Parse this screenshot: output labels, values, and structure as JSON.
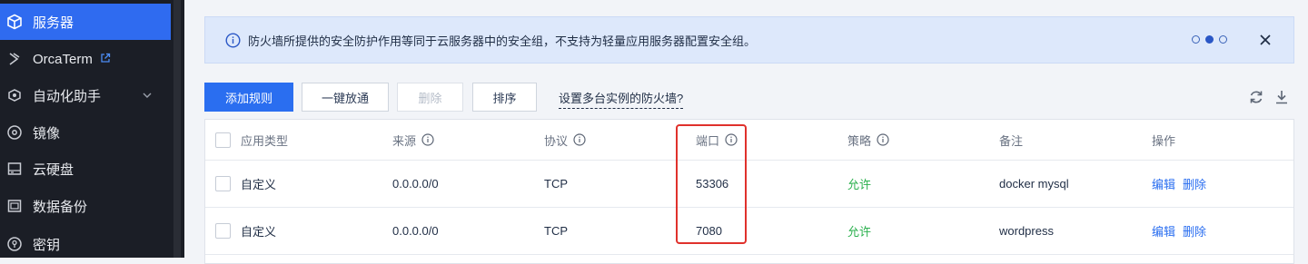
{
  "sidebar": {
    "items": [
      {
        "label": "服务器",
        "icon": "cube-icon",
        "active": true
      },
      {
        "label": "OrcaTerm",
        "icon": "orcaterm-icon",
        "external": true
      },
      {
        "label": "自动化助手",
        "icon": "automation-icon",
        "expandable": true
      },
      {
        "label": "镜像",
        "icon": "image-disc-icon"
      },
      {
        "label": "云硬盘",
        "icon": "disk-icon"
      },
      {
        "label": "数据备份",
        "icon": "backup-icon"
      },
      {
        "label": "密钥",
        "icon": "key-icon"
      }
    ]
  },
  "notice": {
    "text": "防火墙所提供的安全防护作用等同于云服务器中的安全组，不支持为轻量应用服务器配置安全组。"
  },
  "toolbar": {
    "add_rule": "添加规则",
    "one_click": "一键放通",
    "delete": "删除",
    "sort": "排序",
    "help_link": "设置多台实例的防火墙?"
  },
  "table": {
    "headers": [
      "应用类型",
      "来源",
      "协议",
      "端口",
      "策略",
      "备注",
      "操作"
    ],
    "rows": [
      {
        "type": "自定义",
        "source": "0.0.0.0/0",
        "protocol": "TCP",
        "port": "53306",
        "policy": "允许",
        "note": "docker mysql",
        "edit": "编辑",
        "delete": "删除"
      },
      {
        "type": "自定义",
        "source": "0.0.0.0/0",
        "protocol": "TCP",
        "port": "7080",
        "policy": "允许",
        "note": "wordpress",
        "edit": "编辑",
        "delete": "删除"
      }
    ]
  },
  "colors": {
    "accent": "#2a6ef0",
    "allow": "#2bb04e",
    "highlight": "#e0312c"
  }
}
